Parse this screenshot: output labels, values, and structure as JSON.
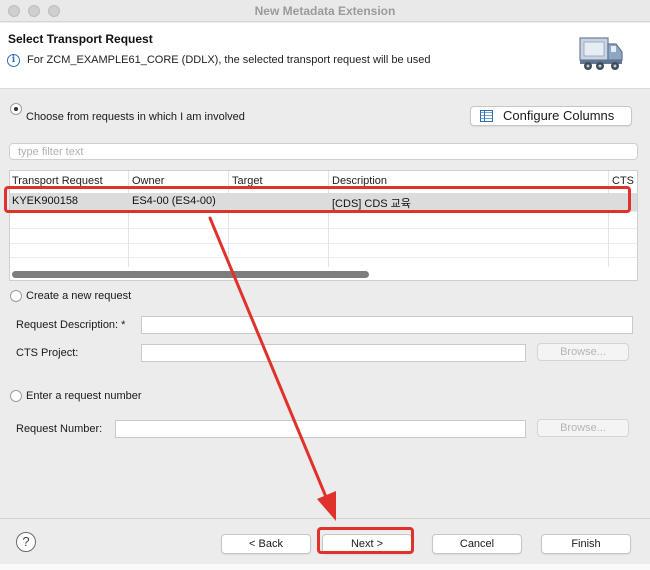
{
  "window": {
    "title": "New Metadata Extension"
  },
  "header": {
    "title": "Select Transport Request",
    "message": "For ZCM_EXAMPLE61_CORE (DDLX), the selected transport request will be used",
    "info_icon": "info-icon",
    "banner_icon": "truck-icon"
  },
  "choose": {
    "label": "Choose from requests in which I am involved",
    "selected": true,
    "configure_label": "Configure Columns"
  },
  "filter": {
    "placeholder": "type filter text",
    "value": ""
  },
  "table": {
    "columns": [
      "Transport Request",
      "Owner",
      "Target",
      "Description",
      "CTS P"
    ],
    "rows": [
      {
        "request": "KYEK900158",
        "owner": "ES4-00 (ES4-00)",
        "target": "",
        "description": "[CDS] CDS 교육",
        "cts": ""
      }
    ]
  },
  "create": {
    "label": "Create a new request",
    "selected": false,
    "desc_label": "Request Description: *",
    "desc_value": "",
    "cts_label": "CTS Project:",
    "cts_value": "",
    "browse_label": "Browse..."
  },
  "enter": {
    "label": "Enter a request number",
    "selected": false,
    "number_label": "Request Number:",
    "number_value": "",
    "browse_label": "Browse..."
  },
  "footer": {
    "help_label": "?",
    "back_label": "< Back",
    "next_label": "Next >",
    "cancel_label": "Cancel",
    "finish_label": "Finish"
  },
  "colors": {
    "annotation": "#e0322a",
    "selected_row": "#dcdcdc"
  }
}
